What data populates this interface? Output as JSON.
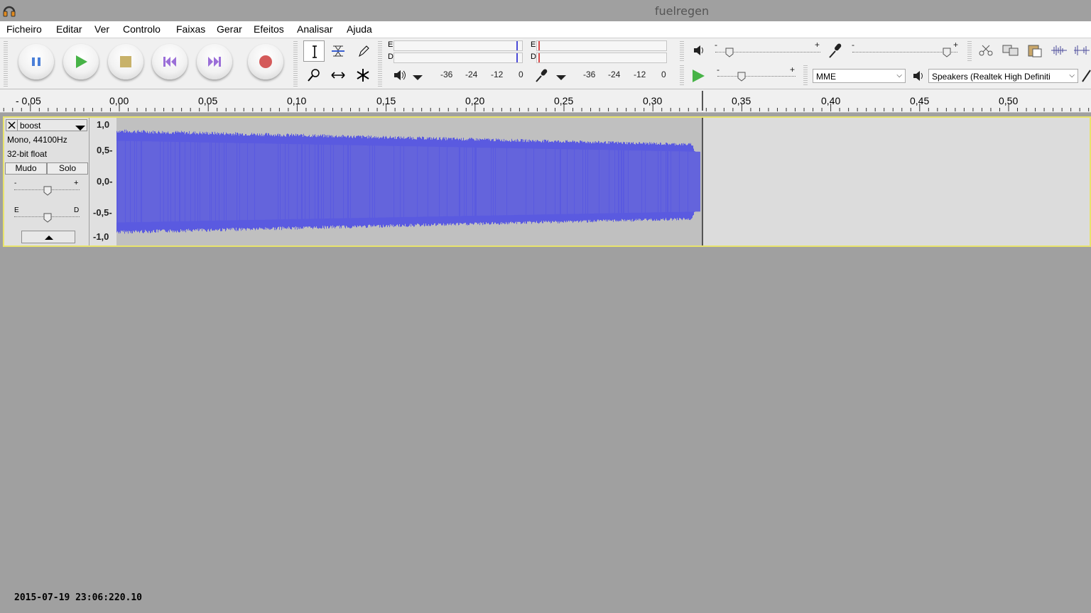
{
  "window": {
    "title": "fuelregen"
  },
  "menu": [
    "Ficheiro",
    "Editar",
    "Ver",
    "Controlo",
    "Faixas",
    "Gerar",
    "Efeitos",
    "Analisar",
    "Ajuda"
  ],
  "transport": {
    "buttons": [
      "pause",
      "play",
      "stop",
      "skip-to-start",
      "skip-to-end",
      "record"
    ]
  },
  "meters": {
    "left_channel": "E",
    "right_channel": "D",
    "play_scale": [
      "-36",
      "-24",
      "-12",
      "0"
    ],
    "record_scale": [
      "-36",
      "-24",
      "-12",
      "0"
    ]
  },
  "mixer": {
    "minus": "-",
    "plus": "+"
  },
  "device": {
    "host": "MME",
    "output": "Speakers (Realtek High Definiti"
  },
  "ruler": {
    "labels": [
      "- 0,05",
      "0,00",
      "0,05",
      "0,10",
      "0,15",
      "0,20",
      "0,25",
      "0,30",
      "0,35",
      "0,40",
      "0,45",
      "0,50"
    ]
  },
  "track": {
    "name": "boost",
    "info1": "Mono, 44100Hz",
    "info2": "32-bit float",
    "mute": "Mudo",
    "solo": "Solo",
    "gain_minus": "-",
    "gain_plus": "+",
    "pan_left": "E",
    "pan_right": "D",
    "y_labels": [
      "1,0",
      "0,5-",
      "0,0-",
      "-0,5-",
      "-1,0"
    ],
    "wave_color": "#5a5ae0",
    "clip_end_seconds": 0.327
  },
  "datestamp": "2015-07-19 23:06:220.10"
}
